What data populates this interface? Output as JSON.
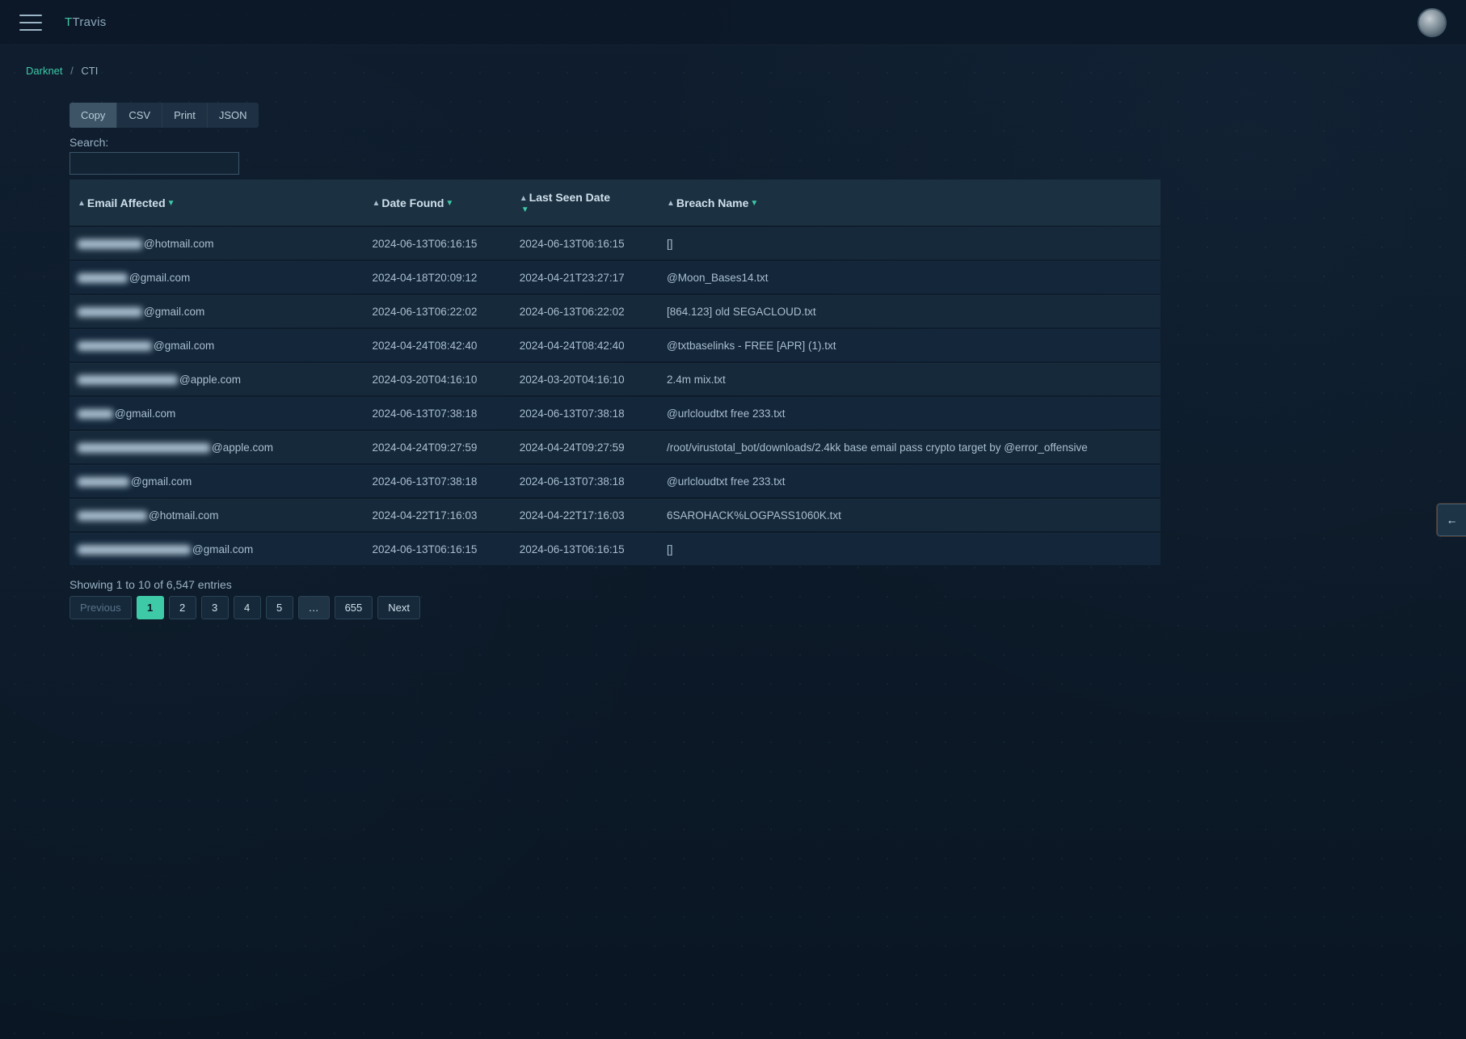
{
  "brand": {
    "accent": "T",
    "rest": "Travis"
  },
  "breadcrumb": {
    "root": "Darknet",
    "sep": "/",
    "current": "CTI"
  },
  "export_buttons": [
    "Copy",
    "CSV",
    "Print",
    "JSON"
  ],
  "search_label": "Search:",
  "columns": {
    "email": "Email Affected",
    "found": "Date Found",
    "seen": "Last Seen Date",
    "breach": "Breach Name"
  },
  "rows": [
    {
      "redact_w": 80,
      "domain": "@hotmail.com",
      "found": "2024-06-13T06:16:15",
      "seen": "2024-06-13T06:16:15",
      "breach": "[]"
    },
    {
      "redact_w": 62,
      "domain": "@gmail.com",
      "found": "2024-04-18T20:09:12",
      "seen": "2024-04-21T23:27:17",
      "breach": "@Moon_Bases14.txt"
    },
    {
      "redact_w": 80,
      "domain": "@gmail.com",
      "found": "2024-06-13T06:22:02",
      "seen": "2024-06-13T06:22:02",
      "breach": "[864.123] old SEGACLOUD.txt"
    },
    {
      "redact_w": 92,
      "domain": "@gmail.com",
      "found": "2024-04-24T08:42:40",
      "seen": "2024-04-24T08:42:40",
      "breach": "@txtbaselinks - FREE [APR] (1).txt"
    },
    {
      "redact_w": 124,
      "domain": "@apple.com",
      "found": "2024-03-20T04:16:10",
      "seen": "2024-03-20T04:16:10",
      "breach": "2.4m mix.txt"
    },
    {
      "redact_w": 44,
      "domain": "@gmail.com",
      "found": "2024-06-13T07:38:18",
      "seen": "2024-06-13T07:38:18",
      "breach": "@urlcloudtxt free 233.txt"
    },
    {
      "redact_w": 164,
      "domain": "@apple.com",
      "found": "2024-04-24T09:27:59",
      "seen": "2024-04-24T09:27:59",
      "breach": "/root/virustotal_bot/downloads/2.4kk base email pass crypto target by @error_offensive"
    },
    {
      "redact_w": 64,
      "domain": "@gmail.com",
      "found": "2024-06-13T07:38:18",
      "seen": "2024-06-13T07:38:18",
      "breach": "@urlcloudtxt free 233.txt"
    },
    {
      "redact_w": 86,
      "domain": "@hotmail.com",
      "found": "2024-04-22T17:16:03",
      "seen": "2024-04-22T17:16:03",
      "breach": "6SAROHACK%LOGPASS1060K.txt"
    },
    {
      "redact_w": 140,
      "domain": "@gmail.com",
      "found": "2024-06-13T06:16:15",
      "seen": "2024-06-13T06:16:15",
      "breach": "[]"
    }
  ],
  "entries_info": "Showing 1 to 10 of 6,547 entries",
  "pagination": {
    "previous": "Previous",
    "pages": [
      "1",
      "2",
      "3",
      "4",
      "5",
      "…",
      "655"
    ],
    "active_index": 0,
    "next": "Next"
  },
  "side_toggle_glyph": "←"
}
